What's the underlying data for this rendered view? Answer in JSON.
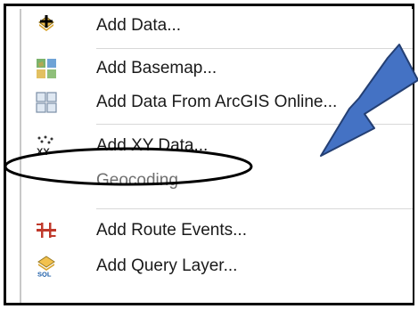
{
  "menu": {
    "items": [
      {
        "label": "Add Data...",
        "icon": "add-data-icon"
      },
      {
        "label": "Add Basemap...",
        "icon": "basemap-icon"
      },
      {
        "label": "Add Data From ArcGIS Online...",
        "icon": "arcgis-online-icon"
      },
      {
        "label": "Add XY Data...",
        "icon": "xy-data-icon"
      },
      {
        "label": "Geocoding",
        "icon": ""
      },
      {
        "label": "Add Route Events...",
        "icon": "route-events-icon"
      },
      {
        "label": "Add Query Layer...",
        "icon": "query-layer-icon"
      }
    ]
  },
  "annotation": {
    "arrow_color": "#4472c4",
    "highlight": "ellipse around Add XY Data"
  }
}
